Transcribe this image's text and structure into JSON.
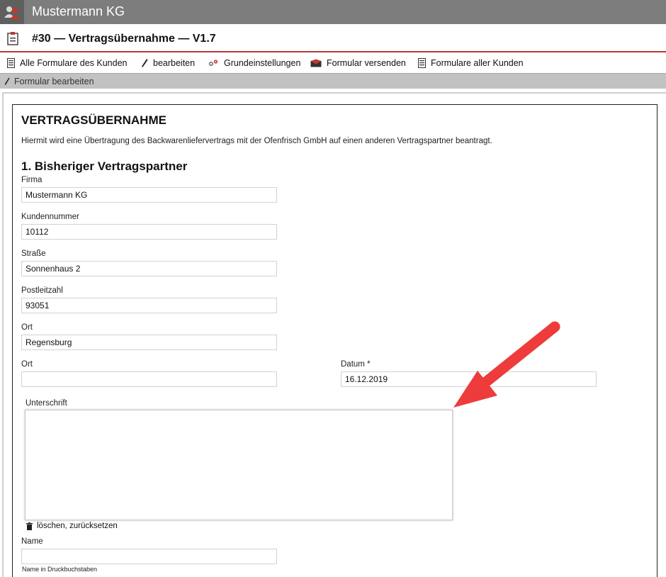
{
  "header": {
    "title": "Mustermann KG",
    "icon": "users-icon"
  },
  "form_header": {
    "title": "#30 — Vertragsübernahme — V1.7",
    "icon": "clipboard-icon"
  },
  "toolbar": {
    "items": [
      {
        "label": "Alle Formulare des Kunden",
        "icon": "document-icon"
      },
      {
        "label": "bearbeiten",
        "icon": "pencil-icon"
      },
      {
        "label": "Grundeinstellungen",
        "icon": "gears-icon"
      },
      {
        "label": "Formular versenden",
        "icon": "envelope-icon"
      },
      {
        "label": "Formulare aller Kunden",
        "icon": "document-icon"
      }
    ]
  },
  "subbar": {
    "label": "Formular bearbeiten",
    "icon": "pencil-icon"
  },
  "form": {
    "heading": "VERTRAGSÜBERNAHME",
    "intro": "Hiermit wird eine Übertragung des Backwarenliefervertrags mit der Ofenfrisch GmbH auf einen anderen Vertragspartner beantragt.",
    "section1": "1. Bisheriger Vertragspartner",
    "fields": {
      "firma": {
        "label": "Firma",
        "value": "Mustermann KG"
      },
      "kundennummer": {
        "label": "Kundennummer",
        "value": "10112"
      },
      "strasse": {
        "label": "Straße",
        "value": "Sonnenhaus 2"
      },
      "plz": {
        "label": "Postleitzahl",
        "value": "93051"
      },
      "ort": {
        "label": "Ort",
        "value": "Regensburg"
      },
      "ort2": {
        "label": "Ort",
        "value": ""
      },
      "datum": {
        "label": "Datum *",
        "value": "16.12.2019"
      },
      "unterschrift": {
        "label": "Unterschrift"
      },
      "name": {
        "label": "Name",
        "value": "",
        "hint": "Name in Druckbuchstaben"
      }
    },
    "clear_label": "löschen, zurücksetzen"
  },
  "colors": {
    "topbar": "#7d7d7d",
    "accent_line": "#b83a3a",
    "arrow": "#ee3b3b"
  }
}
